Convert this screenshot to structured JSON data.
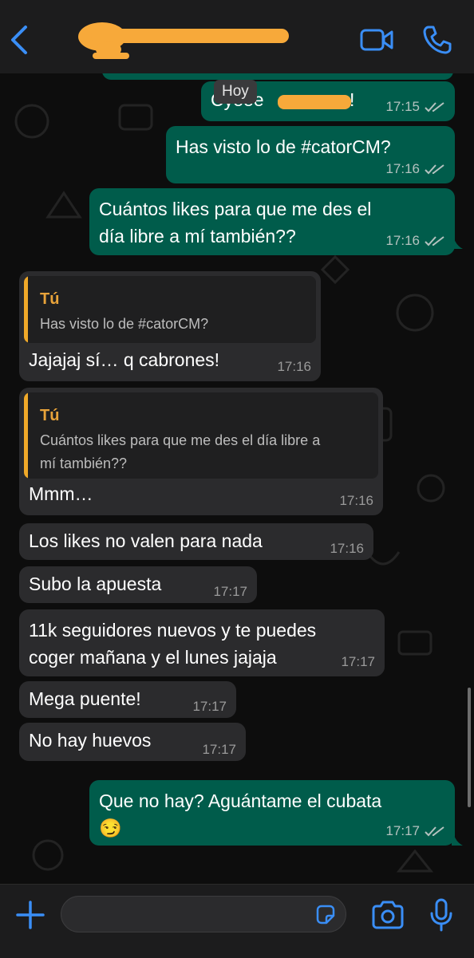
{
  "header": {
    "back_icon": "chevron-left-icon",
    "contact_name_redacted": true,
    "actions": [
      "video-call-icon",
      "phone-call-icon"
    ]
  },
  "chat": {
    "day_separator": "Hoy",
    "messages": [
      {
        "id": "m0",
        "direction": "out",
        "text": "",
        "time": "",
        "status": "read"
      },
      {
        "id": "m1",
        "direction": "out",
        "text": "Cyeee",
        "time": "17:15",
        "status": "read"
      },
      {
        "id": "m2",
        "direction": "out",
        "text": "Has visto lo de #catorCM?",
        "time": "17:16",
        "status": "read"
      },
      {
        "id": "m3",
        "direction": "out",
        "lines": [
          "Cuántos likes para que me des el",
          "día libre a mí también??"
        ],
        "time": "17:16",
        "status": "read"
      },
      {
        "id": "m4",
        "direction": "in",
        "quote": {
          "author": "Tú",
          "text": "Has visto lo de #catorCM?"
        },
        "text": "Jajajaj sí… q cabrones!",
        "time": "17:16"
      },
      {
        "id": "m5",
        "direction": "in",
        "quote": {
          "author": "Tú",
          "lines": [
            "Cuántos likes para que me des el día libre a",
            "mí también??"
          ]
        },
        "text": "Mmm…",
        "time": "17:16"
      },
      {
        "id": "m6",
        "direction": "in",
        "text": "Los likes no valen para nada",
        "time": "17:16"
      },
      {
        "id": "m7",
        "direction": "in",
        "text": "Subo la apuesta",
        "time": "17:17"
      },
      {
        "id": "m8",
        "direction": "in",
        "lines": [
          "11k seguidores nuevos y te puedes",
          "coger mañana y el lunes jajaja"
        ],
        "time": "17:17"
      },
      {
        "id": "m9",
        "direction": "in",
        "text": "Mega puente!",
        "time": "17:17"
      },
      {
        "id": "m10",
        "direction": "in",
        "text": "No hay huevos",
        "time": "17:17"
      },
      {
        "id": "m11",
        "direction": "out",
        "lines": [
          "Que no hay? Aguántame el cubata",
          "😏"
        ],
        "time": "17:17",
        "status": "read"
      }
    ]
  },
  "composer": {
    "placeholder": "",
    "icons": [
      "plus-icon",
      "sticker-icon",
      "camera-icon",
      "microphone-icon"
    ]
  },
  "colors": {
    "outgoing_bubble": "#005c4b",
    "incoming_bubble": "#2b2b2d",
    "accent": "#3a8ef6",
    "quote_bar": "#f0a929",
    "redaction": "#f7a93a"
  }
}
